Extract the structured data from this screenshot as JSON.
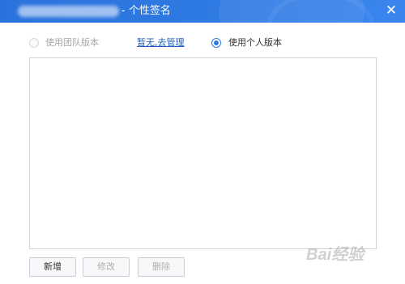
{
  "window": {
    "title": "- 个性签名",
    "close_icon": "close-icon"
  },
  "options": {
    "team_label": "使用团队版本",
    "manage_link": "暂无,去管理",
    "personal_label": "使用个人版本",
    "selected": "personal"
  },
  "buttons": {
    "add": "新增",
    "edit": "修改",
    "delete": "删除"
  },
  "watermark": {
    "text": "Bai经验"
  },
  "colors": {
    "accent": "#2f7ae3",
    "link": "#1f5fbf"
  }
}
